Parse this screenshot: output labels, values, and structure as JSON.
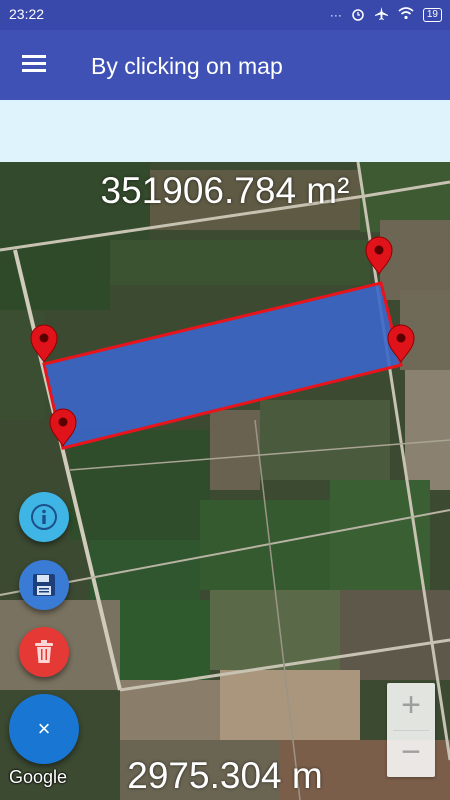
{
  "status_bar": {
    "time": "23:22",
    "icons": [
      "dots-icon",
      "alarm-icon",
      "airplane-icon",
      "wifi-icon",
      "battery-icon"
    ],
    "battery_level": "19"
  },
  "app_bar": {
    "title": "By clicking on map",
    "menu_icon": "hamburger-menu-icon"
  },
  "measurement": {
    "area": "351906.784 m²",
    "perimeter": "2975.304 m"
  },
  "polygon": {
    "fill_color": "#3b66c9",
    "stroke_color": "#e8141b",
    "marker_color": "#e0121a",
    "marker_count": 4
  },
  "fabs": [
    {
      "name": "info",
      "icon": "info-icon",
      "color": "#3fb5e5"
    },
    {
      "name": "save",
      "icon": "save-icon",
      "color": "#3a7bd5"
    },
    {
      "name": "delete",
      "icon": "trash-icon",
      "color": "#e53935"
    },
    {
      "name": "close",
      "icon": "close-icon",
      "color": "#1976d2"
    }
  ],
  "zoom": {
    "in_label": "+",
    "out_label": "−"
  },
  "map_attribution": "Google",
  "close_label": "×"
}
